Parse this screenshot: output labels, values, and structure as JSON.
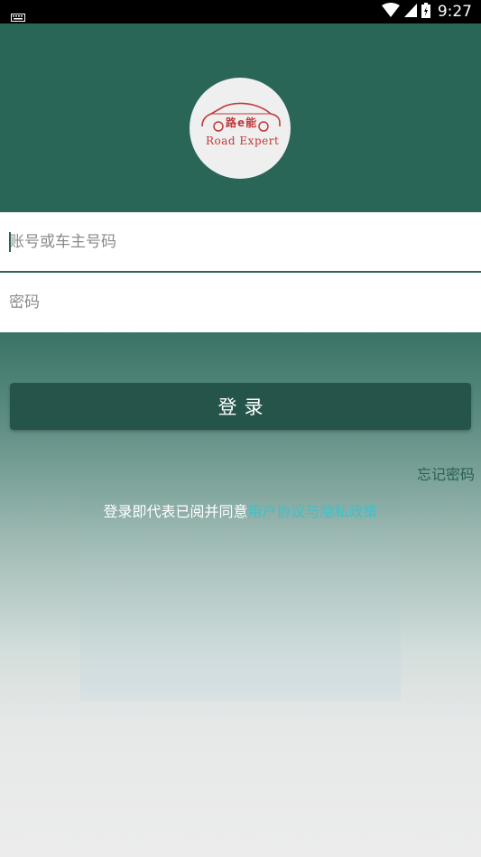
{
  "status_bar": {
    "time": "9:27",
    "icons": [
      "keyboard-icon",
      "wifi-icon",
      "signal-icon",
      "battery-icon"
    ]
  },
  "logo": {
    "chinese_name": "路e能",
    "english_name": "Road Expert",
    "brand_color": "#c0393b"
  },
  "form": {
    "account_placeholder": "账号或车主号码",
    "password_placeholder": "密码"
  },
  "login_button_label": "登录",
  "forgot_password_label": "忘记密码",
  "agreement": {
    "prefix": "登录即代表已阅并同意",
    "link": "用户协议与隐私政策"
  },
  "colors": {
    "primary": "#2a6658",
    "button": "#24544a",
    "link": "#3fc1c9"
  }
}
